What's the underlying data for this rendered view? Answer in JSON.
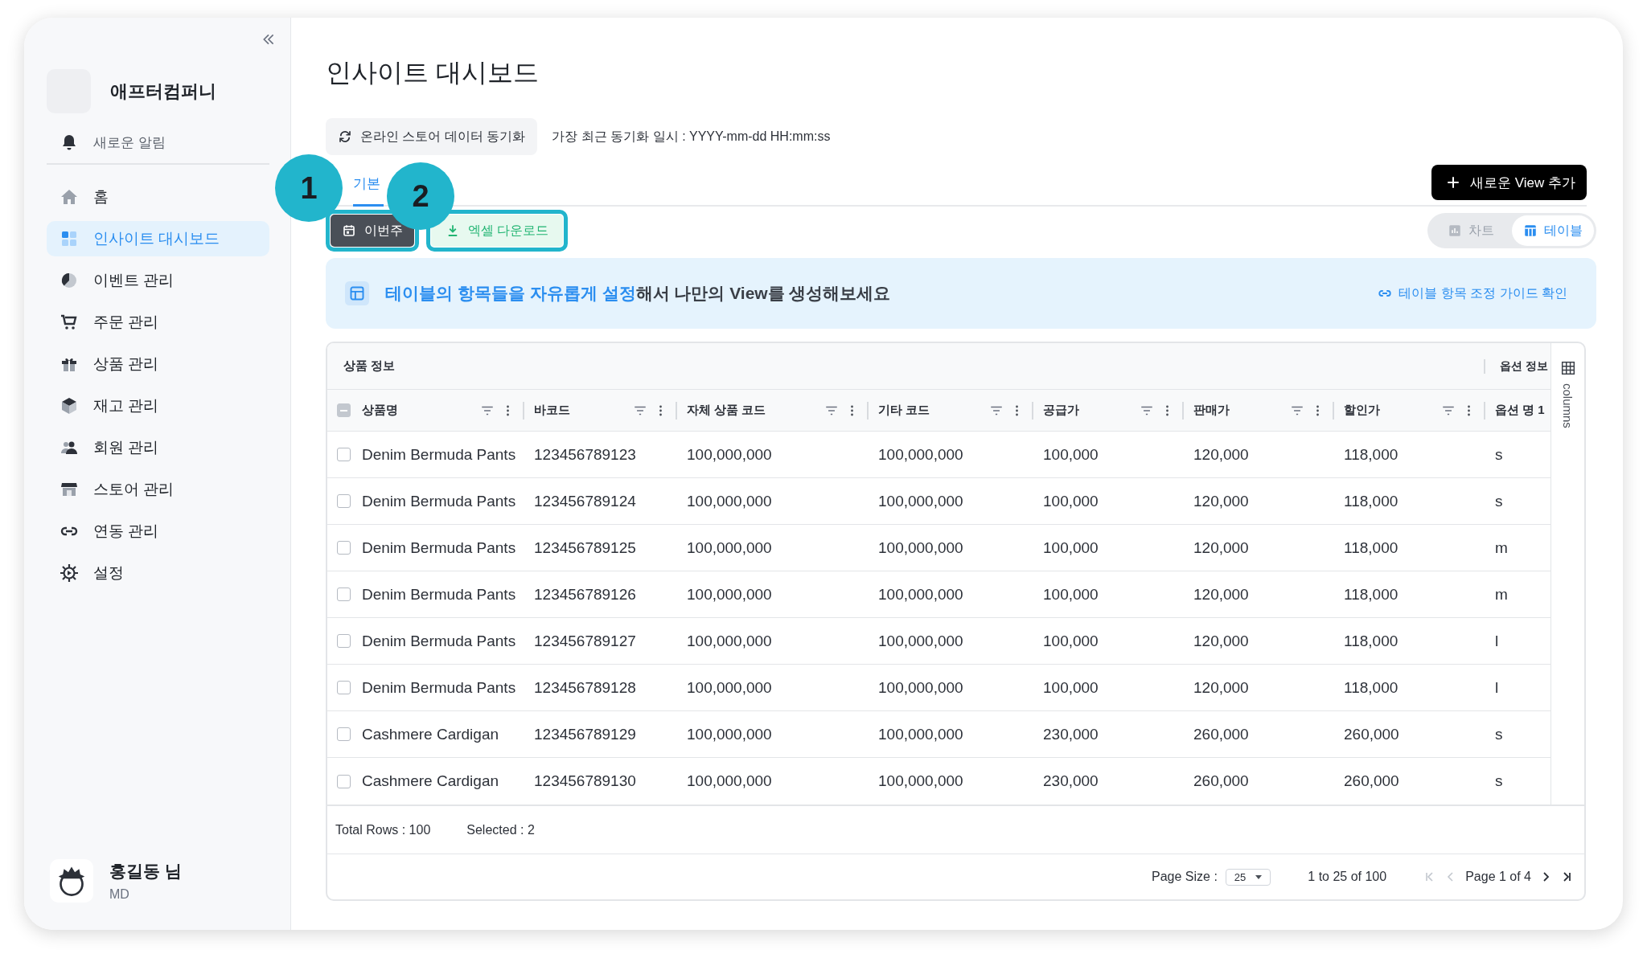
{
  "sidebar": {
    "company": "애프터컴퍼니",
    "notice": "새로운 알림",
    "items": [
      {
        "label": "홈",
        "selected": false
      },
      {
        "label": "인사이트 대시보드",
        "selected": true
      },
      {
        "label": "이벤트 관리",
        "selected": false
      },
      {
        "label": "주문 관리",
        "selected": false
      },
      {
        "label": "상품 관리",
        "selected": false
      },
      {
        "label": "재고 관리",
        "selected": false
      },
      {
        "label": "회원 관리",
        "selected": false
      },
      {
        "label": "스토어 관리",
        "selected": false
      },
      {
        "label": "연동 관리",
        "selected": false
      },
      {
        "label": "설정",
        "selected": false
      }
    ],
    "user": {
      "name": "홍길동 님",
      "role": "MD"
    }
  },
  "page": {
    "title": "인사이트 대시보드",
    "sync_button": "온라인 스토어 데이터 동기화",
    "last_sync": "가장 최근 동기화 일시 : YYYY-mm-dd HH:mm:ss",
    "tabs": [
      {
        "label": "기본",
        "selected": true
      }
    ],
    "new_view_button": "새로운 View 추가",
    "actions": [
      {
        "kind": "period",
        "label": "이번주",
        "highlighted": true
      },
      {
        "kind": "download",
        "label": "엑셀 다운로드",
        "highlighted": true
      }
    ],
    "callouts": [
      {
        "label": "1"
      },
      {
        "label": "2"
      }
    ],
    "view_toggle": [
      {
        "label": "차트",
        "selected": false
      },
      {
        "label": "테이블",
        "selected": true
      }
    ],
    "banner": {
      "text": "**테이블의 항목들을 자유롭게 설정**해서 나만의 View를 생성해보세요",
      "link": "테이블 항목 조정 가이드 확인"
    }
  },
  "table": {
    "groups": [
      {
        "label": "상품 정보"
      },
      {
        "label": "옵션 정보"
      }
    ],
    "header_checkbox": {
      "indeterminate": true
    },
    "columns": [
      "상품명",
      "바코드",
      "자체 상품 코드",
      "기타 코드",
      "공급가",
      "판매가",
      "할인가",
      "옵션 명 1"
    ],
    "side_panel": "columns",
    "rows": [
      {
        "checked": false,
        "cells": [
          "Denim Bermuda Pants",
          "123456789123",
          "100,000,000",
          "100,000,000",
          "100,000",
          "120,000",
          "118,000",
          "s"
        ]
      },
      {
        "checked": false,
        "cells": [
          "Denim Bermuda Pants",
          "123456789124",
          "100,000,000",
          "100,000,000",
          "100,000",
          "120,000",
          "118,000",
          "s"
        ]
      },
      {
        "checked": false,
        "cells": [
          "Denim Bermuda Pants",
          "123456789125",
          "100,000,000",
          "100,000,000",
          "100,000",
          "120,000",
          "118,000",
          "m"
        ]
      },
      {
        "checked": false,
        "cells": [
          "Denim Bermuda Pants",
          "123456789126",
          "100,000,000",
          "100,000,000",
          "100,000",
          "120,000",
          "118,000",
          "m"
        ]
      },
      {
        "checked": false,
        "cells": [
          "Denim Bermuda Pants",
          "123456789127",
          "100,000,000",
          "100,000,000",
          "100,000",
          "120,000",
          "118,000",
          "l"
        ]
      },
      {
        "checked": false,
        "cells": [
          "Denim Bermuda Pants",
          "123456789128",
          "100,000,000",
          "100,000,000",
          "100,000",
          "120,000",
          "118,000",
          "l"
        ]
      },
      {
        "checked": false,
        "cells": [
          "Cashmere Cardigan",
          "123456789129",
          "100,000,000",
          "100,000,000",
          "230,000",
          "260,000",
          "260,000",
          "s"
        ]
      },
      {
        "checked": false,
        "cells": [
          "Cashmere Cardigan",
          "123456789130",
          "100,000,000",
          "100,000,000",
          "230,000",
          "260,000",
          "260,000",
          "s"
        ]
      }
    ],
    "total_rows": "Total Rows : 100",
    "selected_count": "Selected : 2",
    "page_size_label": "Page Size :",
    "page_size": "25",
    "range": "1 to 25 of 100",
    "page": "Page 1 of 4"
  }
}
